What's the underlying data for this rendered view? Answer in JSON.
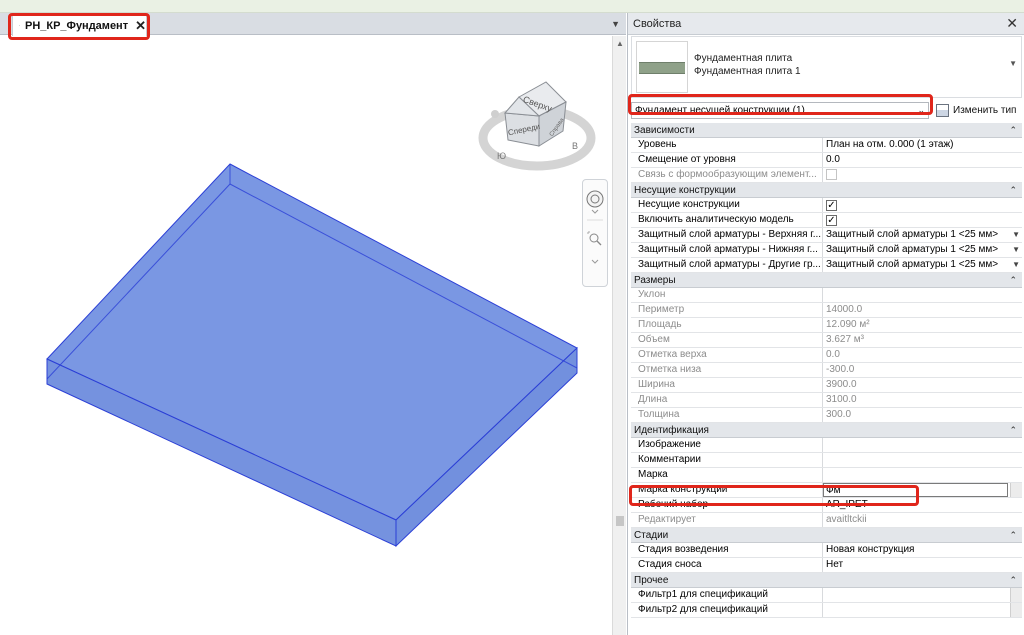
{
  "view": {
    "tab_label": "РН_КР_Фундамент",
    "tab_close": "✕",
    "viewcube": {
      "top_face": "Сверху",
      "front_face": "Спереди",
      "right_face": "Справа"
    }
  },
  "properties": {
    "title": "Свойства",
    "close": "✕",
    "type_family": "Фундаментная плита",
    "type_name": "Фундаментная плита 1",
    "instance_filter": "Фундамент несущей конструкции (1)",
    "edit_type_label": "Изменить тип",
    "sections": [
      {
        "title": "Зависимости",
        "rows": [
          {
            "name": "Уровень",
            "value": "План на отм. 0.000 (1 этаж)"
          },
          {
            "name": "Смещение от уровня",
            "value": "0.0"
          },
          {
            "name": "Связь с формообразующим элемент...",
            "value": ""
          }
        ]
      },
      {
        "title": "Несущие конструкции",
        "rows": [
          {
            "name": "Несущие конструкции",
            "value": ""
          },
          {
            "name": "Включить аналитическую модель",
            "value": ""
          },
          {
            "name": "Защитный слой арматуры - Верхняя г...",
            "value": "Защитный слой арматуры 1 <25 мм>"
          },
          {
            "name": "Защитный слой арматуры - Нижняя г...",
            "value": "Защитный слой арматуры 1 <25 мм>"
          },
          {
            "name": "Защитный слой арматуры - Другие гр...",
            "value": "Защитный слой арматуры 1 <25 мм>"
          }
        ]
      },
      {
        "title": "Размеры",
        "rows": [
          {
            "name": "Уклон",
            "value": ""
          },
          {
            "name": "Периметр",
            "value": "14000.0"
          },
          {
            "name": "Площадь",
            "value": "12.090 м²"
          },
          {
            "name": "Объем",
            "value": "3.627 м³"
          },
          {
            "name": "Отметка верха",
            "value": "0.0"
          },
          {
            "name": "Отметка низа",
            "value": "-300.0"
          },
          {
            "name": "Ширина",
            "value": "3900.0"
          },
          {
            "name": "Длина",
            "value": "3100.0"
          },
          {
            "name": "Толщина",
            "value": "300.0"
          }
        ]
      },
      {
        "title": "Идентификация",
        "rows": [
          {
            "name": "Изображение",
            "value": ""
          },
          {
            "name": "Комментарии",
            "value": ""
          },
          {
            "name": "Марка",
            "value": ""
          },
          {
            "name": "Марка конструкции",
            "value": "Фм"
          },
          {
            "name": "Рабочий набор",
            "value": "AR_IPET"
          },
          {
            "name": "Редактирует",
            "value": "avaitltckii"
          }
        ]
      },
      {
        "title": "Стадии",
        "rows": [
          {
            "name": "Стадия возведения",
            "value": "Новая конструкция"
          },
          {
            "name": "Стадия сноса",
            "value": "Нет"
          }
        ]
      },
      {
        "title": "Прочее",
        "rows": [
          {
            "name": "Фильтр1 для спецификаций",
            "value": ""
          },
          {
            "name": "Фильтр2 для спецификаций",
            "value": ""
          }
        ]
      }
    ]
  },
  "colors": {
    "slab_fill": "#7a97e3",
    "slab_edge": "#2b3fd6",
    "highlight_red": "#e0261b"
  }
}
